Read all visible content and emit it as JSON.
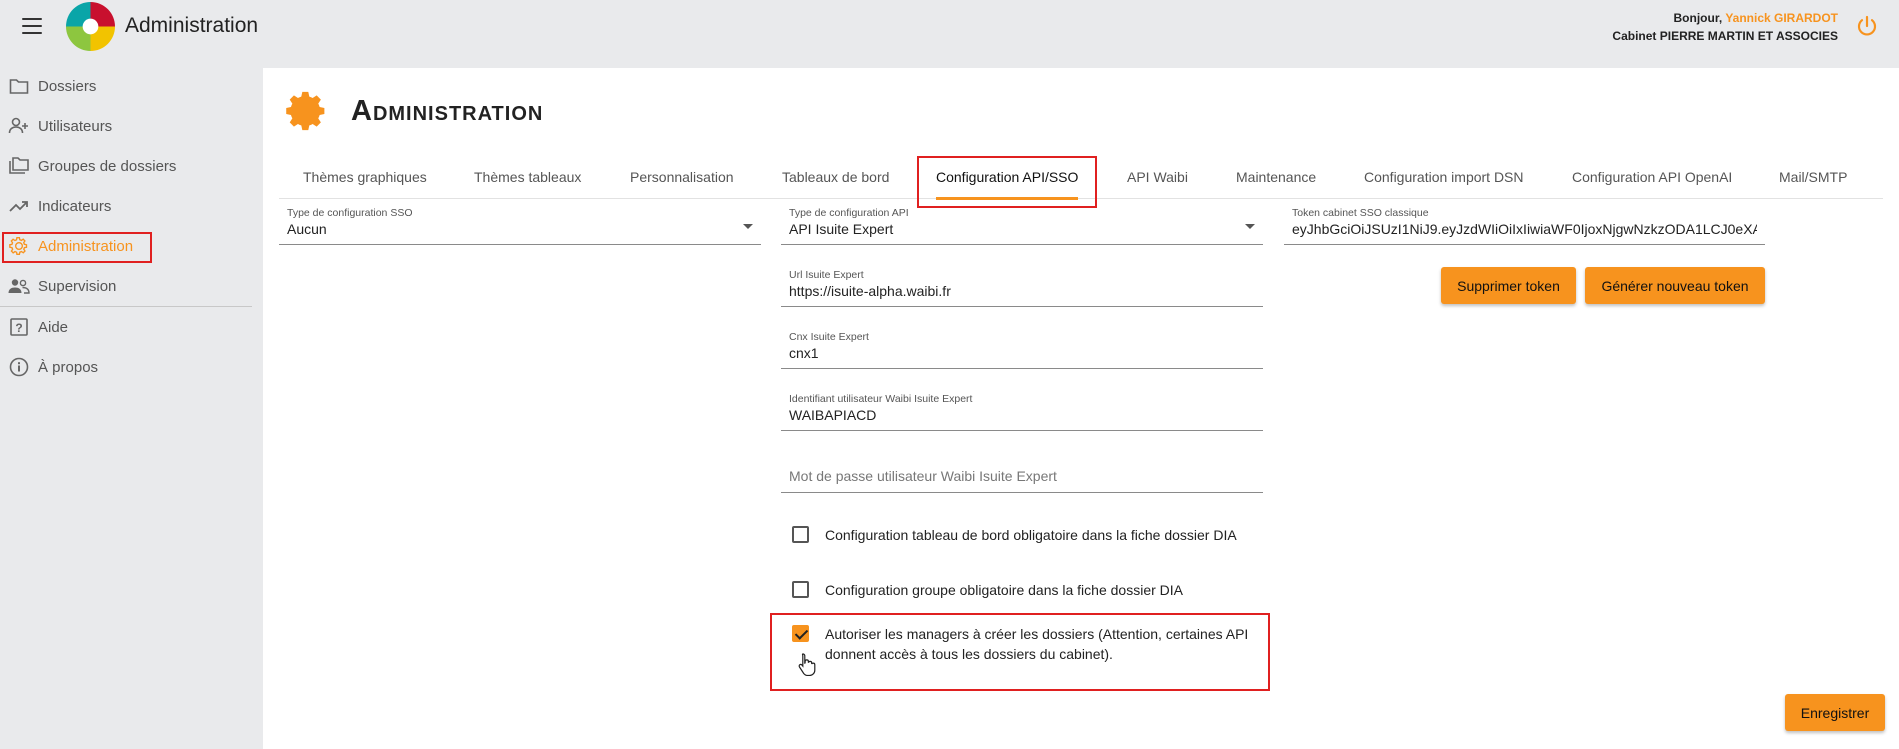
{
  "header": {
    "app_title": "Administration",
    "greeting_prefix": "Bonjour,",
    "user_name": "Yannick GIRARDOT",
    "cabinet": "Cabinet PIERRE MARTIN ET ASSOCIES"
  },
  "sidebar": {
    "items": [
      {
        "label": "Dossiers",
        "icon": "folder-icon"
      },
      {
        "label": "Utilisateurs",
        "icon": "user-plus-icon"
      },
      {
        "label": "Groupes de dossiers",
        "icon": "folders-icon"
      },
      {
        "label": "Indicateurs",
        "icon": "trending-up-icon"
      },
      {
        "label": "Administration",
        "icon": "gear-icon",
        "active": true
      },
      {
        "label": "Supervision",
        "icon": "people-icon"
      },
      {
        "label": "Aide",
        "icon": "help-icon"
      },
      {
        "label": "À propos",
        "icon": "info-icon"
      }
    ]
  },
  "page": {
    "title": "Administration"
  },
  "tabs": [
    "Thèmes graphiques",
    "Thèmes tableaux",
    "Personnalisation",
    "Tableaux de bord",
    "Configuration API/SSO",
    "API Waibi",
    "Maintenance",
    "Configuration import DSN",
    "Configuration API OpenAI",
    "Mail/SMTP"
  ],
  "active_tab": "Configuration API/SSO",
  "form": {
    "sso_type": {
      "label": "Type de configuration SSO",
      "value": "Aucun"
    },
    "api_type": {
      "label": "Type de configuration API",
      "value": "API Isuite Expert"
    },
    "token": {
      "label": "Token cabinet SSO classique",
      "value": "eyJhbGciOiJSUzI1NiJ9.eyJzdWIiOiIxIiwiaWF0IjoxNjgwNzkzODA1LCJ0eXA"
    },
    "url": {
      "label": "Url Isuite Expert",
      "value": "https://isuite-alpha.waibi.fr"
    },
    "cnx": {
      "label": "Cnx Isuite Expert",
      "value": "cnx1"
    },
    "user_id": {
      "label": "Identifiant utilisateur Waibi Isuite Expert",
      "value": "WAIBAPIACD"
    },
    "password": {
      "placeholder": "Mot de passe utilisateur Waibi Isuite Expert"
    },
    "delete_token_label": "Supprimer token",
    "generate_token_label": "Générer nouveau token",
    "checkboxes": [
      {
        "label": "Configuration tableau de bord obligatoire dans la fiche dossier DIA",
        "checked": false
      },
      {
        "label": "Configuration groupe obligatoire dans la fiche dossier DIA",
        "checked": false
      },
      {
        "label": "Autoriser les managers à créer les dossiers (Attention, certaines API donnent accès à tous les dossiers du cabinet).",
        "checked": true
      }
    ],
    "save_label": "Enregistrer"
  },
  "colors": {
    "accent": "#f7931e",
    "highlight": "#e02020",
    "sidebar_bg": "#e9eaec"
  }
}
